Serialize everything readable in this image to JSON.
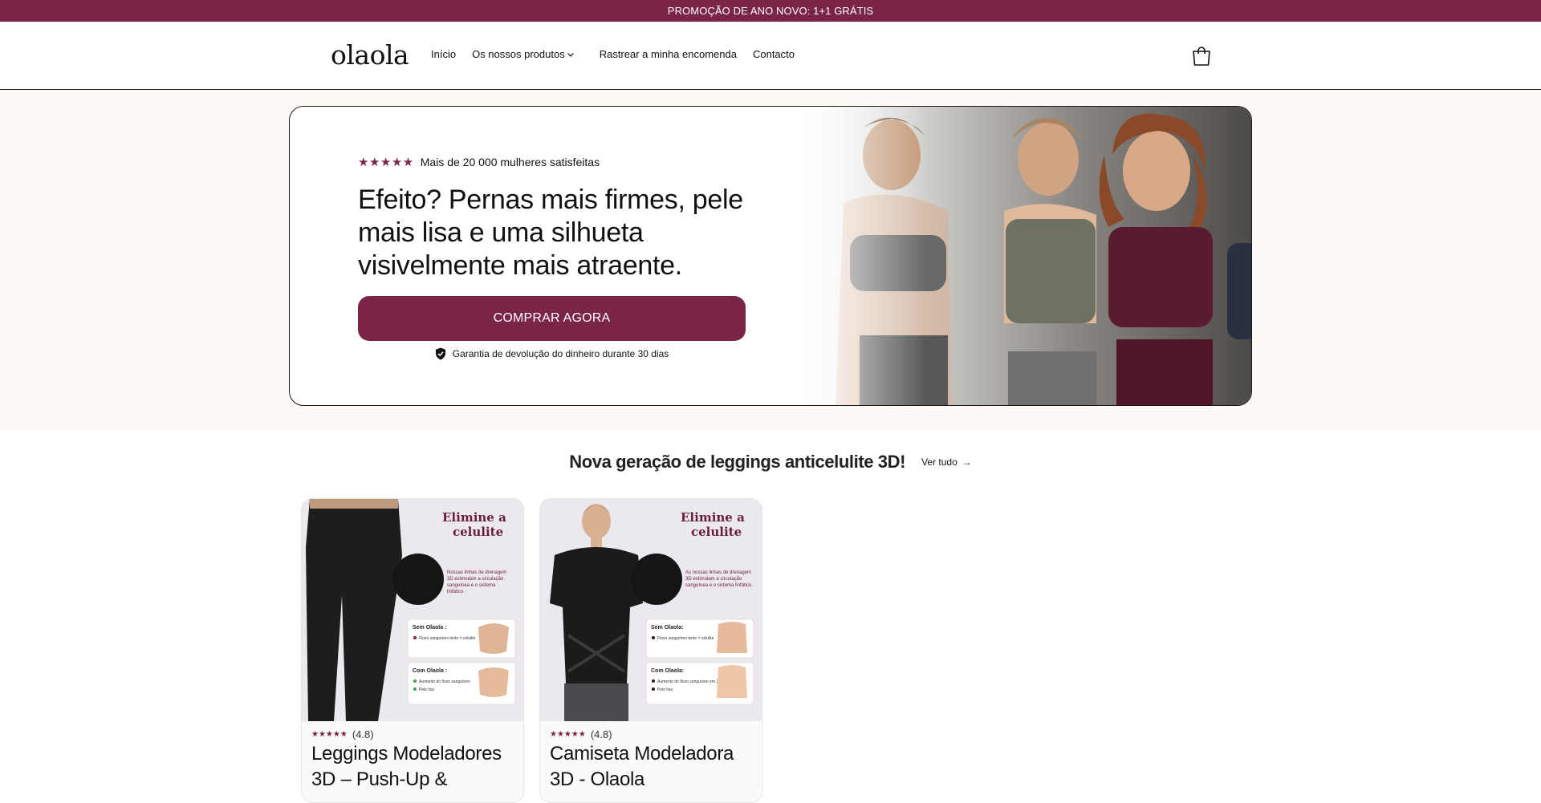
{
  "announcement": {
    "text": "PROMOÇÃO DE ANO NOVO: 1+1 GRÁTIS"
  },
  "header": {
    "logo": "olaola",
    "nav": [
      {
        "label": "Início"
      },
      {
        "label": "Os nossos produtos"
      },
      {
        "label": "Rastrear a minha encomenda"
      },
      {
        "label": "Contacto"
      }
    ],
    "cart_icon": "shopping-bag-icon"
  },
  "hero": {
    "stars": "★★★★★",
    "rating_text": "Mais de 20 000 mulheres satisfeitas",
    "headline": "Efeito? Pernas mais firmes, pele mais lisa e uma silhueta visivelmente mais atraente.",
    "cta_label": "COMPRAR AGORA",
    "guarantee": "Garantia de devolução do dinheiro durante 30 dias",
    "image_icon": "hero-photo-women"
  },
  "section": {
    "title": "Nova geração de leggings anticelulite 3D!",
    "see_all": "Ver tudo",
    "see_all_arrow": "→"
  },
  "products": [
    {
      "image_heading": "Elimine a celulite",
      "image_caption": "Nossas linhas de drenagem 3D estimulam a circulação sanguínea e o sistema linfático.",
      "image_without": "Sem Olaola :",
      "image_without_note": "Fluxo sanguíneo lento = celulite",
      "image_with": "Com Olaola :",
      "image_with_note1": "Aumento do fluxo sanguíneo em 30%",
      "image_with_note2": "Pele lisa",
      "stars": "★★★★★",
      "rating": "(4.8)",
      "title": "Leggings Modeladores 3D – Push-Up &"
    },
    {
      "image_heading": "Elimine a celulite",
      "image_caption": "As nossas linhas de drenagem 3D estimulam a circulação sanguínea e o sistema linfático.",
      "image_without": "Sem Olaola:",
      "image_without_note": "Fluxo sanguíneo lento = celulite",
      "image_with": "Com Olaola:",
      "image_with_note1": "Aumento do fluxo sanguíneo em 30%",
      "image_with_note2": "Pele lisa",
      "stars": "★★★★★",
      "rating": "(4.8)",
      "title": "Camiseta Modeladora 3D - Olaola"
    }
  ],
  "colors": {
    "brand": "#7a2448",
    "border": "#1a1a1a"
  }
}
